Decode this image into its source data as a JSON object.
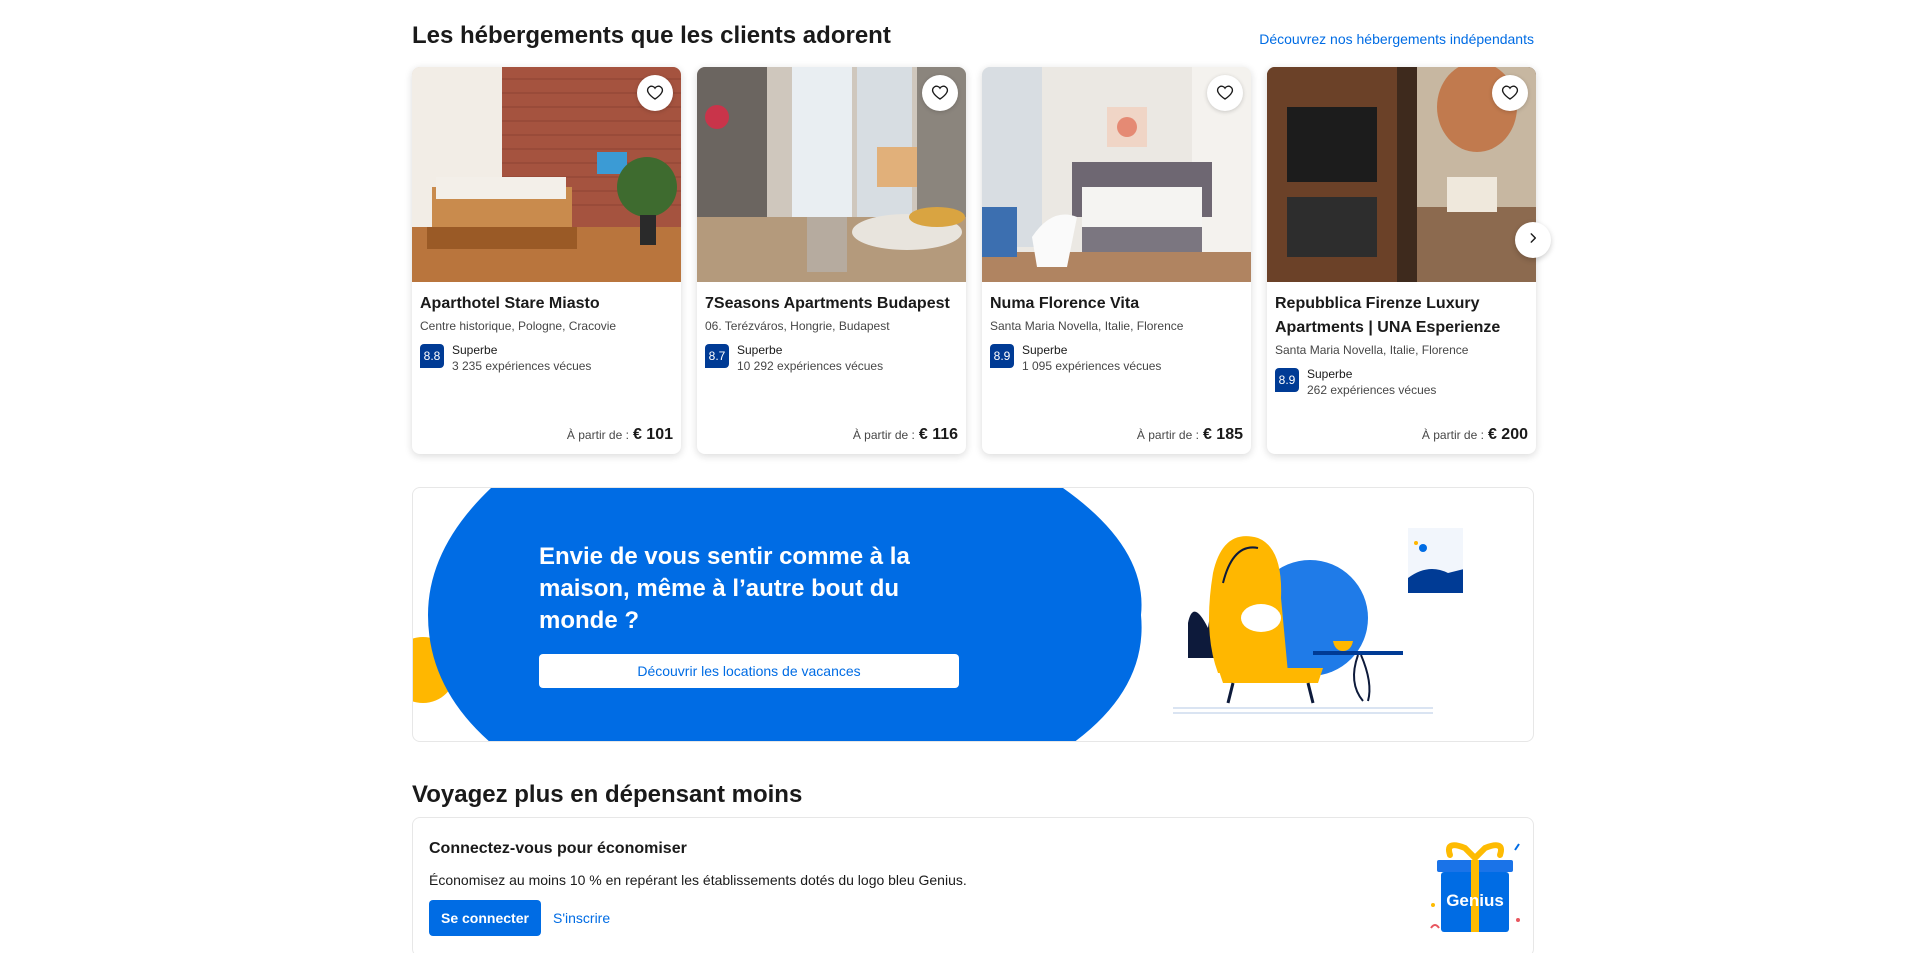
{
  "section1": {
    "title": "Les hébergements que les clients adorent",
    "link": "Découvrez nos hébergements indépendants"
  },
  "cards": [
    {
      "name_line1": "Aparthotel Stare Miasto",
      "name_line2": "",
      "location": "Centre historique, Pologne, Cracovie",
      "score": "8.8",
      "rating_word": "Superbe",
      "reviews": "3 235 expériences vécues",
      "price_label": "À partir de :",
      "price": "€ 101"
    },
    {
      "name_line1": "7Seasons Apartments Budapest",
      "name_line2": "",
      "location": "06. Terézváros, Hongrie, Budapest",
      "score": "8.7",
      "rating_word": "Superbe",
      "reviews": "10 292 expériences vécues",
      "price_label": "À partir de :",
      "price": "€ 116"
    },
    {
      "name_line1": "Numa Florence Vita",
      "name_line2": "",
      "location": "Santa Maria Novella, Italie, Florence",
      "score": "8.9",
      "rating_word": "Superbe",
      "reviews": "1 095 expériences vécues",
      "price_label": "À partir de :",
      "price": "€ 185"
    },
    {
      "name_line1": "Repubblica Firenze Luxury",
      "name_line2": "Apartments | UNA Esperienze",
      "location": "Santa Maria Novella, Italie, Florence",
      "score": "8.9",
      "rating_word": "Superbe",
      "reviews": "262 expériences vécues",
      "price_label": "À partir de :",
      "price": "€ 200"
    }
  ],
  "banner": {
    "title": "Envie de vous sentir comme à la maison, même à l’autre bout du monde ?",
    "button": "Découvrir les locations de vacances"
  },
  "section2": {
    "title": "Voyagez plus en dépensant moins",
    "box_title": "Connectez-vous pour économiser",
    "box_desc": "Économisez au moins 10 % en repérant les établissements dotés du logo bleu Genius.",
    "login": "Se connecter",
    "signup": "S'inscrire",
    "genius_logo": "Genius"
  },
  "icons": {
    "favorite": "heart-icon",
    "next": "chevron-right-icon"
  },
  "colors": {
    "brand_blue": "#006ce4",
    "score_blue": "#003b95",
    "accent_yellow": "#febb02"
  }
}
